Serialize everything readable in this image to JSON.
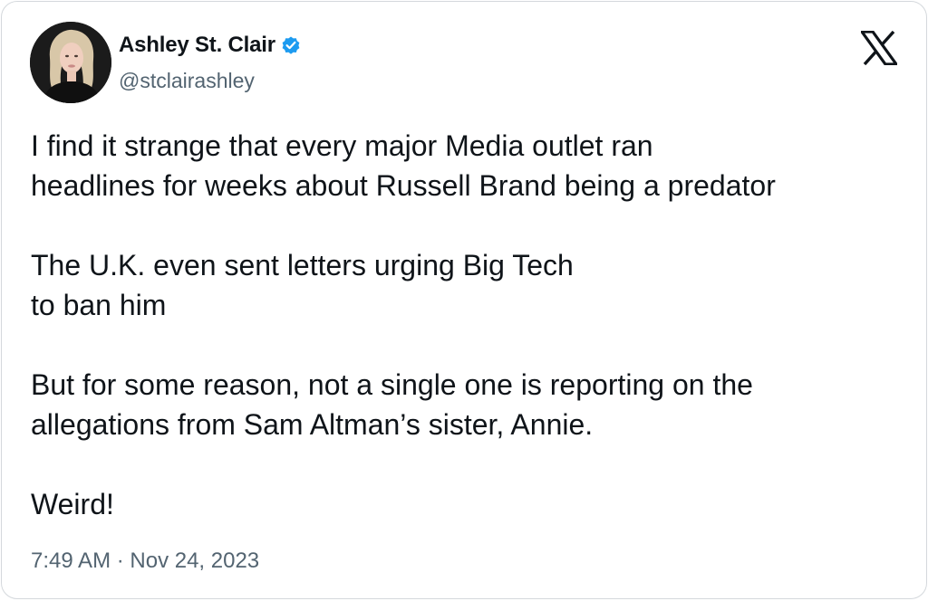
{
  "author": {
    "display_name": "Ashley St. Clair",
    "handle": "@stclairashley",
    "verified": true,
    "verified_color": "#1d9bf0"
  },
  "platform_icon": "x-logo-icon",
  "tweet": {
    "paragraphs": [
      [
        "I find it strange that every major Media outlet ran",
        "headlines for weeks about Russell Brand being a predator"
      ],
      [
        "The U.K. even sent letters urging Big Tech",
        "to ban him"
      ],
      [
        "But for some reason, not a single one is reporting on the",
        "allegations from Sam Altman’s sister, Annie."
      ],
      [
        "Weird!"
      ]
    ]
  },
  "timestamp": "7:49 AM · Nov 24, 2023",
  "colors": {
    "text_primary": "#0f1419",
    "text_secondary": "#536471",
    "border": "#d4d8dc"
  }
}
